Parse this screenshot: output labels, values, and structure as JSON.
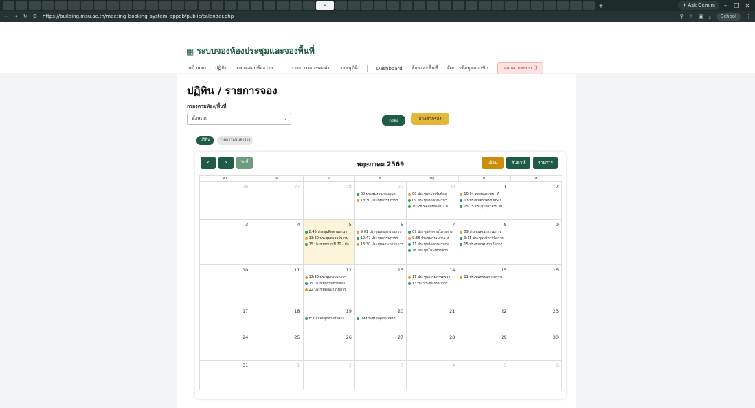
{
  "browser": {
    "url": "https://building.msu.ac.th/meeting_booking_system_appdb/public/calendar.php",
    "gemini_label": "Ask Gemini",
    "profile_label": "School"
  },
  "header": {
    "brand": "ระบบจองห้องประชุมและจองพื้นที่",
    "nav": [
      "หน้าแรก",
      "ปฏิทิน",
      "ตรวจสอบห้องว่าง",
      "รายการจองของฉัน",
      "รออนุมัติ",
      "Dashboard",
      "ห้องและพื้นที่",
      "จัดการข้อมูลสมาชิก"
    ],
    "logout": "ออกจากระบบ ()"
  },
  "main": {
    "title": "ปฏิทิน / รายการจอง",
    "filter_label": "กรองตามห้อง/พื้นที่",
    "filter_value": "ทั้งหมด",
    "filter_button": "กรอง",
    "clear_button": "ล้างตัวกรอง",
    "view_calendar": "ปฏิทิน",
    "view_list": "รายการแบบตาราง"
  },
  "calendar": {
    "today_button": "วันนี้",
    "month_title": "พฤษภาคม 2569",
    "views": [
      "เดือน",
      "สัปดาห์",
      "รายการ"
    ],
    "dow": [
      "อา.",
      "จ.",
      "อ.",
      "พ.",
      "พฤ.",
      "ศ.",
      "ส."
    ],
    "colors": {
      "green": "#2e9e6a",
      "orange": "#e4a12a"
    },
    "weeks": [
      [
        {
          "n": "26",
          "other": true,
          "events": []
        },
        {
          "n": "27",
          "other": true,
          "events": []
        },
        {
          "n": "28",
          "other": true,
          "events": []
        },
        {
          "n": "29",
          "other": true,
          "events": [
            {
              "t": "09 ประชุมงานควบคุมฯ",
              "c": "green"
            },
            {
              "t": "13:30 ประชุมกรรมการฯ",
              "c": "orange"
            }
          ]
        },
        {
          "n": "30",
          "other": true,
          "events": [
            {
              "t": "09 ประชุมตรวจรับพัสดุ",
              "c": "orange"
            },
            {
              "t": "09 ประชุมติดตามงานฯ",
              "c": "green"
            },
            {
              "t": "10:28 ทดสอบระบบ - คื",
              "c": "green"
            }
          ]
        },
        {
          "n": "1",
          "events": [
            {
              "t": "10:04 ทดสอบระบบ - คื",
              "c": "orange"
            },
            {
              "t": "13 ประชุมตรวจรับ MSU",
              "c": "green"
            },
            {
              "t": "15:15 ประชุมตรวจรับ M",
              "c": "green"
            }
          ]
        },
        {
          "n": "2",
          "events": []
        }
      ],
      [
        {
          "n": "3",
          "events": []
        },
        {
          "n": "4",
          "events": []
        },
        {
          "n": "5",
          "today": true,
          "events": [
            {
              "t": "8:45 ประชุมติดตามงานฯ",
              "c": "green"
            },
            {
              "t": "13:30 ประชุมตรวจรับงาน",
              "c": "orange"
            },
            {
              "t": "15 ประชุมขบวนปี 70 - ห้อ",
              "c": "green"
            }
          ]
        },
        {
          "n": "6",
          "events": [
            {
              "t": "9:01 ประชุมคณะกรรมการ",
              "c": "orange"
            },
            {
              "t": "12:47 ประชุมกรรมการฯ",
              "c": "green"
            },
            {
              "t": "13:30 ประชุมคณะกรรมการ",
              "c": "orange"
            }
          ]
        },
        {
          "n": "7",
          "events": [
            {
              "t": "09 ประชุมติดตามโครงการ",
              "c": "green"
            },
            {
              "t": "9:38 ประชุมกรรมการ ห",
              "c": "orange"
            },
            {
              "t": "11 ประชุมติดตามงานก่อ",
              "c": "green"
            },
            {
              "t": "16 ประชุมโครงการควบ",
              "c": "green"
            }
          ]
        },
        {
          "n": "8",
          "events": [
            {
              "t": "09 ประชุมคณะกรรมการ",
              "c": "orange"
            },
            {
              "t": "9:15 ประชุมบริหารจัดการ",
              "c": "green"
            },
            {
              "t": "15 ประชุมกลุ่มงานจัดการ",
              "c": "green"
            }
          ]
        },
        {
          "n": "9",
          "events": []
        }
      ],
      [
        {
          "n": "10",
          "events": []
        },
        {
          "n": "11",
          "events": []
        },
        {
          "n": "12",
          "events": [
            {
              "t": "13:30 ประชุมกรรมการฯ",
              "c": "orange"
            },
            {
              "t": "15 ประชุมกรรมการสอบ",
              "c": "green"
            },
            {
              "t": "22 ประชุมคณะกรรมการ",
              "c": "orange"
            }
          ]
        },
        {
          "n": "13",
          "events": []
        },
        {
          "n": "14",
          "events": [
            {
              "t": "11 ประชุมกรรมการตรวจ",
              "c": "orange"
            },
            {
              "t": "13:30 ประชุมกรรมการ",
              "c": "green"
            }
          ]
        },
        {
          "n": "15",
          "events": [
            {
              "t": "11 ประชุมกรรมการตรวจ",
              "c": "orange"
            }
          ]
        },
        {
          "n": "16",
          "events": []
        }
      ],
      [
        {
          "n": "17",
          "events": []
        },
        {
          "n": "18",
          "events": []
        },
        {
          "n": "19",
          "events": [
            {
              "t": "8:30 สอบลูกจ้างชั่วครา",
              "c": "green"
            }
          ]
        },
        {
          "n": "20",
          "events": [
            {
              "t": "09 ประชุมกลุ่มงานพัฒน",
              "c": "green"
            }
          ]
        },
        {
          "n": "21",
          "events": []
        },
        {
          "n": "22",
          "events": []
        },
        {
          "n": "23",
          "events": []
        }
      ],
      [
        {
          "n": "24",
          "events": []
        },
        {
          "n": "25",
          "events": []
        },
        {
          "n": "26",
          "events": []
        },
        {
          "n": "27",
          "events": []
        },
        {
          "n": "28",
          "events": []
        },
        {
          "n": "29",
          "events": []
        },
        {
          "n": "30",
          "events": []
        }
      ],
      [
        {
          "n": "31",
          "events": []
        },
        {
          "n": "1",
          "other": true,
          "events": []
        },
        {
          "n": "2",
          "other": true,
          "events": []
        },
        {
          "n": "3",
          "other": true,
          "events": []
        },
        {
          "n": "4",
          "other": true,
          "events": []
        },
        {
          "n": "5",
          "other": true,
          "events": []
        },
        {
          "n": "6",
          "other": true,
          "events": []
        }
      ]
    ]
  }
}
